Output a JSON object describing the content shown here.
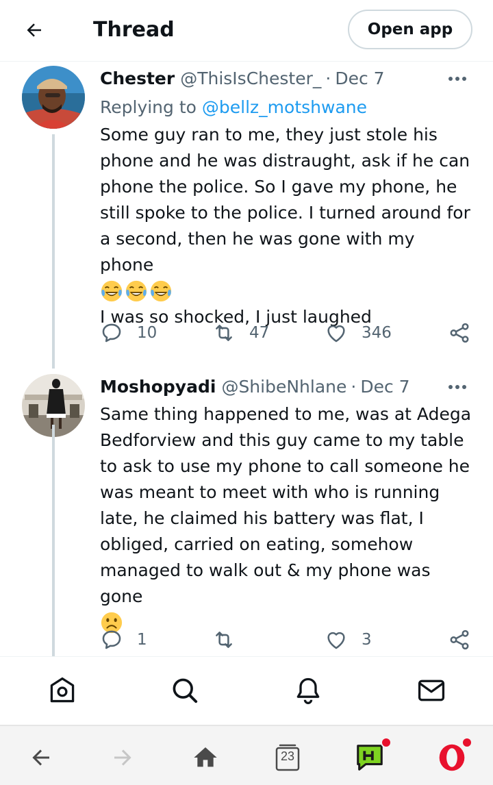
{
  "header": {
    "title": "Thread",
    "open_app": "Open app"
  },
  "tweets": [
    {
      "name": "Chester",
      "handle": "@ThisIsChester_",
      "separator": "·",
      "date": "Dec 7",
      "replying_prefix": "Replying to",
      "replying_to": "@bellz_motshwane",
      "text_lines": [
        "Some guy ran to me, they just stole his",
        "phone and he was distraught, ask if he can",
        "phone the police. So I gave my phone, he",
        "still spoke to the police. I turned around for",
        "a second, then he was gone with my phone"
      ],
      "emojis": [
        "face-with-tears-of-joy",
        "face-with-tears-of-joy",
        "face-with-tears-of-joy"
      ],
      "text_after": "I was so shocked, I just laughed",
      "replies": "10",
      "retweets": "47",
      "likes": "346"
    },
    {
      "name": "Moshopyadi",
      "handle": "@ShibeNhlane",
      "separator": "·",
      "date": "Dec 7",
      "text_lines": [
        "Same thing happened to me, was at Adega",
        "Bedforview and this guy came to my table",
        "to ask to use my phone to call someone he",
        "was meant to meet with who is running",
        "late, he claimed his battery was flat, I",
        "obliged, carried on eating, somehow",
        "managed to walk out & my phone was gone"
      ],
      "emojis": [
        "frowning-face"
      ],
      "replies": "1",
      "retweets": "",
      "likes": "3"
    }
  ],
  "browser": {
    "tabs_count": "23"
  },
  "colors": {
    "accent": "#1d9bf0",
    "text": "#0f1419",
    "muted": "#536471",
    "opera_red": "#e8112d",
    "hype_green": "#7ed321"
  }
}
